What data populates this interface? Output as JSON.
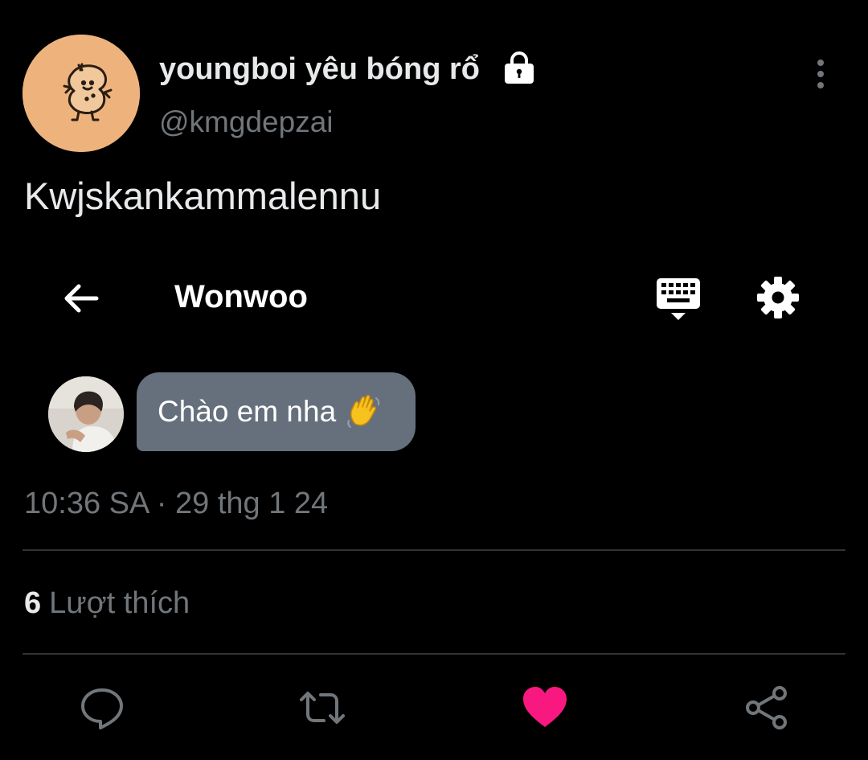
{
  "tweet": {
    "author": {
      "display_name": "youngboi yêu bóng rổ",
      "handle": "@kmgdepzai",
      "avatar_color": "#eeb37d",
      "protected_icon": "lock-icon"
    },
    "text": "Kwjskankammalennu",
    "timestamp": "10:36 SA · 29 thg 1 24",
    "likes_count": "6",
    "likes_label": "Lượt thích",
    "liked": true,
    "like_color": "#f91880"
  },
  "embedded_chat": {
    "title": "Wonwoo",
    "message": "Chào em nha",
    "message_emoji": "waving-hand-icon",
    "bubble_color": "#66707c"
  },
  "actions": [
    {
      "name": "reply",
      "icon": "comment-icon"
    },
    {
      "name": "retweet",
      "icon": "retweet-icon"
    },
    {
      "name": "like",
      "icon": "heart-icon"
    },
    {
      "name": "share",
      "icon": "share-icon"
    }
  ],
  "colors": {
    "background": "#000000",
    "text_primary": "#e7e9ea",
    "text_secondary": "#71767b",
    "divider": "#2f3336"
  }
}
